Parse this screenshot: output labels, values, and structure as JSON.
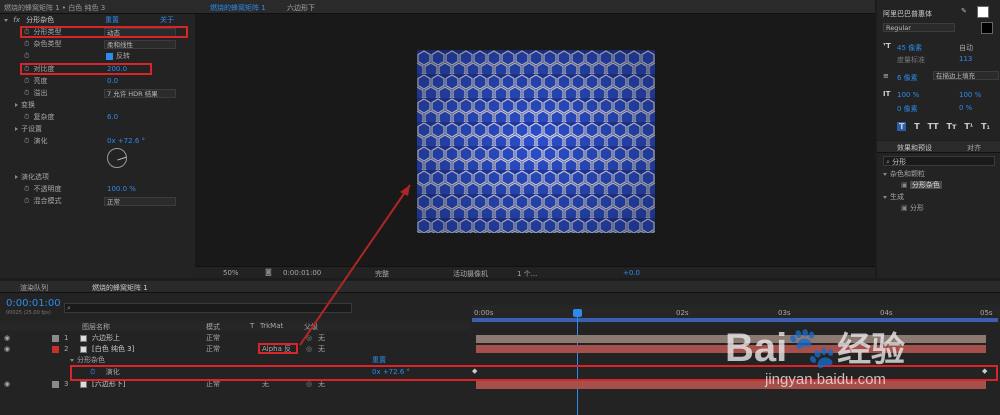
{
  "effect_controls": {
    "title": "燃烧的蜂窝矩阵 1 • 白色 纯色 3",
    "fx_name": "分形杂色",
    "reset": "重置",
    "about": "关于",
    "props": [
      {
        "label": "分形类型",
        "value": "动态",
        "kind": "dropdown"
      },
      {
        "label": "杂色类型",
        "value": "柔和线性",
        "kind": "dropdown"
      },
      {
        "label": "",
        "value": "反转",
        "kind": "checkbox"
      },
      {
        "label": "对比度",
        "value": "200.0",
        "kind": "number"
      },
      {
        "label": "亮度",
        "value": "0.0",
        "kind": "number"
      },
      {
        "label": "溢出",
        "value": "7 允许 HDR 结果",
        "kind": "dropdown"
      },
      {
        "label": "变换",
        "value": "",
        "kind": "group"
      },
      {
        "label": "复杂度",
        "value": "6.0",
        "kind": "number"
      },
      {
        "label": "子设置",
        "value": "",
        "kind": "group"
      },
      {
        "label": "演化",
        "value": "0x +72.6 °",
        "kind": "number"
      },
      {
        "label": "演化选项",
        "value": "",
        "kind": "group"
      },
      {
        "label": "不透明度",
        "value": "100.0 %",
        "kind": "number"
      },
      {
        "label": "混合模式",
        "value": "正常",
        "kind": "dropdown"
      }
    ]
  },
  "composition": {
    "tabs": [
      "燃烧的蜂窝矩阵 1",
      "六边形下"
    ],
    "zoom": "50%",
    "time": "0:00:01:00",
    "quality": "完整",
    "camera": "活动摄像机",
    "views": "1 个...",
    "exposure": "+0.0"
  },
  "character": {
    "font": "阿里巴巴普惠体",
    "style": "Regular",
    "size": "45 像素",
    "leading": "自动",
    "tracking": "113",
    "kerning": "度量标准",
    "stroke": "6 像素",
    "stroke_mode": "在描边上填充",
    "vscale": "100 %",
    "hscale": "100 %",
    "baseline": "0 像素",
    "tsume": "0 %",
    "style_buttons": [
      "T",
      "T",
      "TT",
      "Tт",
      "T¹",
      "T₁"
    ]
  },
  "effects_presets": {
    "title": "效果和预设",
    "other_tab": "对齐",
    "search": "分形",
    "groups": [
      {
        "name": "杂色和颗粒",
        "items": [
          "分形杂色"
        ]
      },
      {
        "name": "生成",
        "items": [
          "分形"
        ]
      }
    ]
  },
  "timeline": {
    "tabs": [
      "渲染队列",
      "燃烧的蜂窝矩阵 1"
    ],
    "timecode": "0:00:01:00",
    "fps": "00025 (25.00 fps)",
    "columns": [
      "图层名称",
      "模式",
      "T",
      "TrkMat",
      "父级"
    ],
    "ruler": [
      "0:00s",
      "02s",
      "03s",
      "04s",
      "05s"
    ],
    "layers": [
      {
        "num": "1",
        "name": "六边形上",
        "mode": "正常",
        "trkmat": "",
        "parent": "无",
        "color": "#8a8a8a"
      },
      {
        "num": "2",
        "name": "[白色 纯色 3]",
        "mode": "正常",
        "trkmat": "Alpha 反",
        "parent": "无",
        "color": "#c8302a"
      },
      {
        "num": "3",
        "name": "[六边形下]",
        "mode": "正常",
        "trkmat": "无",
        "parent": "无",
        "color": "#8a8a8a"
      }
    ],
    "effect_group": "分形杂色",
    "effect_reset": "重置",
    "evolution": "演化",
    "evolution_value": "0x +72.6 °"
  },
  "watermark": {
    "brand": "Bai",
    "brand2": "经验",
    "url": "jingyan.baidu.com"
  }
}
